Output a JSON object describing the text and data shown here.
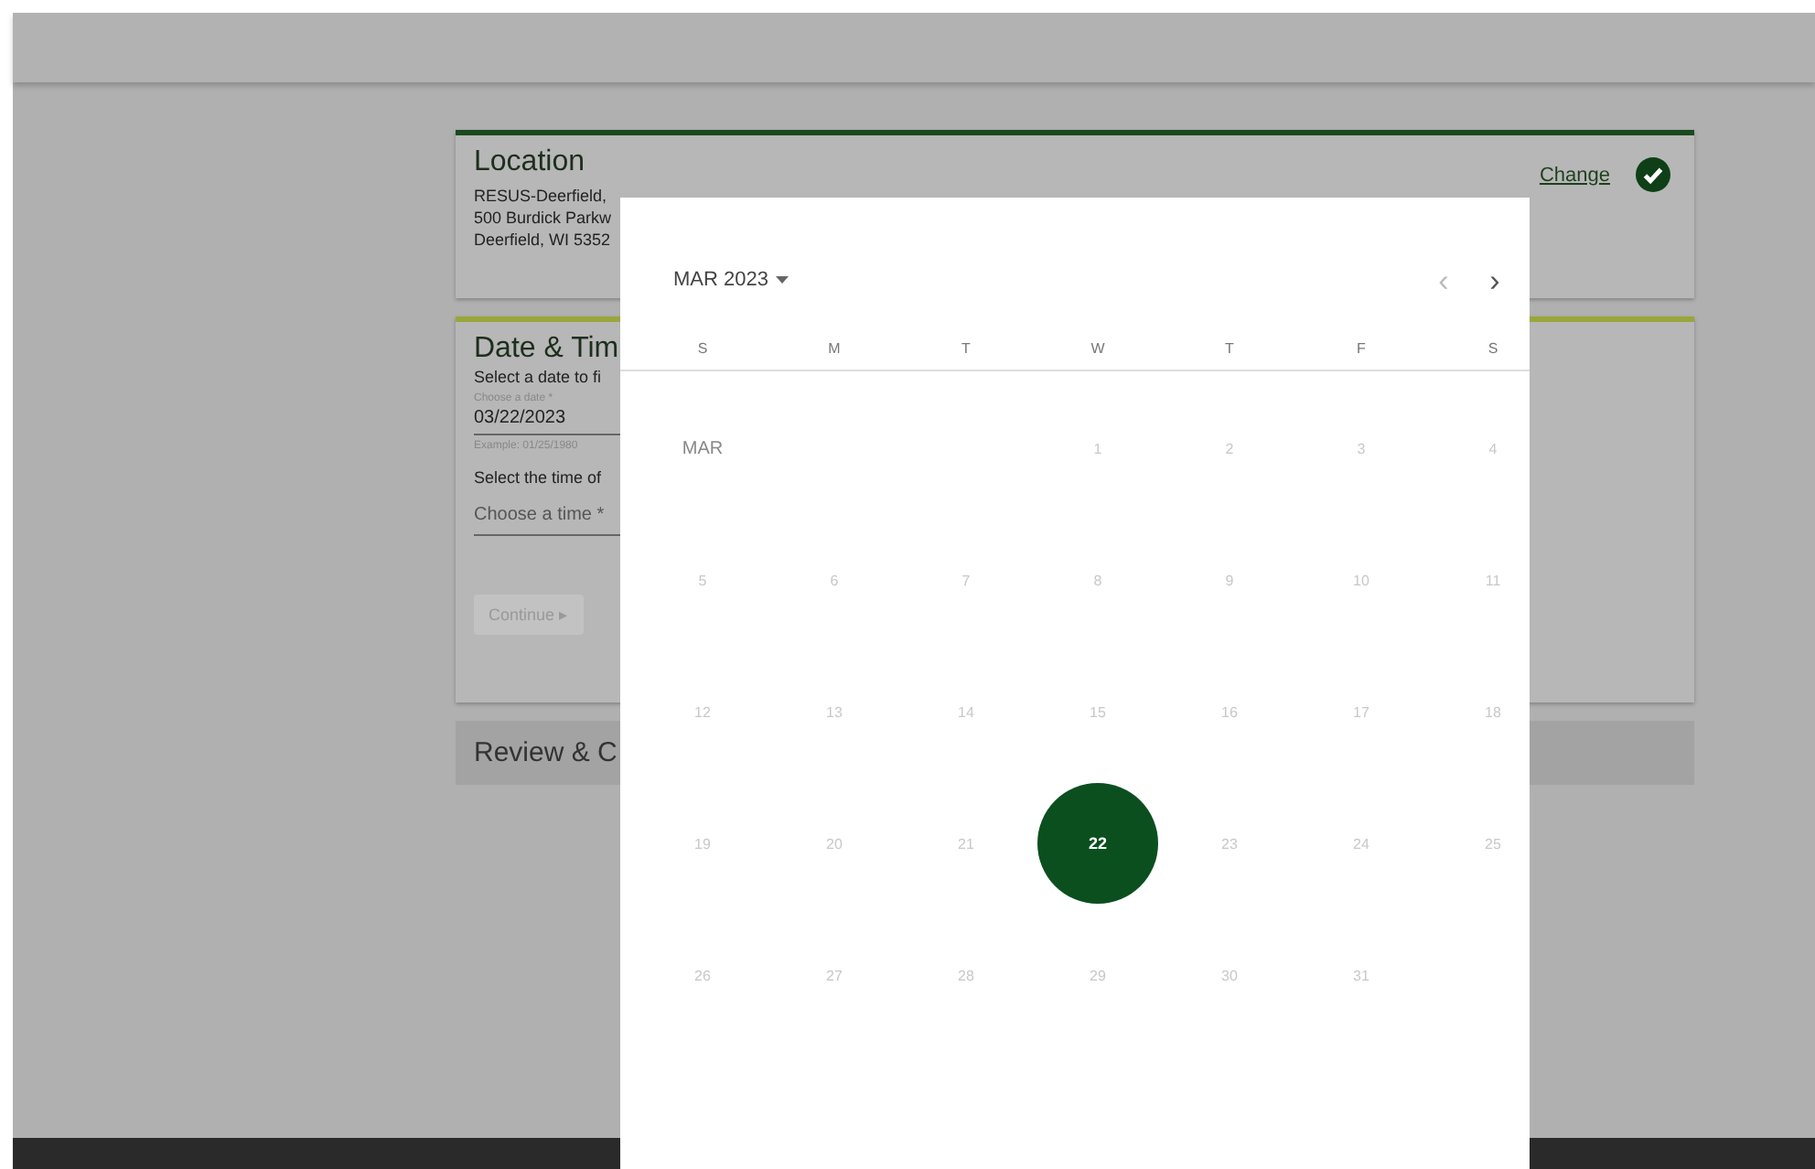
{
  "location": {
    "title": "Location",
    "lines": [
      "RESUS-Deerfield,",
      "500 Burdick Parkw",
      "Deerfield, WI 5352"
    ],
    "change_link": "Change",
    "completed": true
  },
  "date_time": {
    "title": "Date & Tim",
    "date_prompt": "Select a date to fi",
    "date_field": {
      "label": "Choose a date *",
      "value": "03/22/2023",
      "hint": "Example: 01/25/1980"
    },
    "time_prompt": "Select the time of",
    "time_field": {
      "placeholder": "Choose a time *"
    },
    "continue_button": {
      "label": "Continue ▸",
      "disabled": true
    }
  },
  "review": {
    "title": "Review & C"
  },
  "date_picker": {
    "period": "MAR 2023",
    "prev": "‹",
    "next": "›",
    "weekdays": [
      "S",
      "M",
      "T",
      "W",
      "T",
      "F",
      "S"
    ],
    "month_label": "MAR",
    "weeks": [
      {
        "days": [
          {
            "label": "1",
            "selected": false,
            "disabled": true
          },
          {
            "label": "2",
            "selected": false,
            "disabled": true
          },
          {
            "label": "3",
            "selected": false,
            "disabled": true
          },
          {
            "label": "4",
            "selected": false,
            "disabled": true
          }
        ]
      },
      {
        "days": [
          {
            "label": "5",
            "selected": false,
            "disabled": true
          },
          {
            "label": "6",
            "selected": false,
            "disabled": true
          },
          {
            "label": "7",
            "selected": false,
            "disabled": true
          },
          {
            "label": "8",
            "selected": false,
            "disabled": true
          },
          {
            "label": "9",
            "selected": false,
            "disabled": true
          },
          {
            "label": "10",
            "selected": false,
            "disabled": true
          },
          {
            "label": "11",
            "selected": false,
            "disabled": true
          }
        ]
      },
      {
        "days": [
          {
            "label": "12",
            "selected": false,
            "disabled": true
          },
          {
            "label": "13",
            "selected": false,
            "disabled": true
          },
          {
            "label": "14",
            "selected": false,
            "disabled": true
          },
          {
            "label": "15",
            "selected": false,
            "disabled": true
          },
          {
            "label": "16",
            "selected": false,
            "disabled": true
          },
          {
            "label": "17",
            "selected": false,
            "disabled": true
          },
          {
            "label": "18",
            "selected": false,
            "disabled": true
          }
        ]
      },
      {
        "days": [
          {
            "label": "19",
            "selected": false,
            "disabled": true
          },
          {
            "label": "20",
            "selected": false,
            "disabled": true
          },
          {
            "label": "21",
            "selected": false,
            "disabled": true
          },
          {
            "label": "22",
            "selected": true,
            "disabled": false
          },
          {
            "label": "23",
            "selected": false,
            "disabled": true
          },
          {
            "label": "24",
            "selected": false,
            "disabled": true
          },
          {
            "label": "25",
            "selected": false,
            "disabled": true
          }
        ]
      },
      {
        "days": [
          {
            "label": "26",
            "selected": false,
            "disabled": true
          },
          {
            "label": "27",
            "selected": false,
            "disabled": true
          },
          {
            "label": "28",
            "selected": false,
            "disabled": true
          },
          {
            "label": "29",
            "selected": false,
            "disabled": true
          },
          {
            "label": "30",
            "selected": false,
            "disabled": true
          },
          {
            "label": "31",
            "selected": false,
            "disabled": true
          }
        ]
      }
    ]
  }
}
